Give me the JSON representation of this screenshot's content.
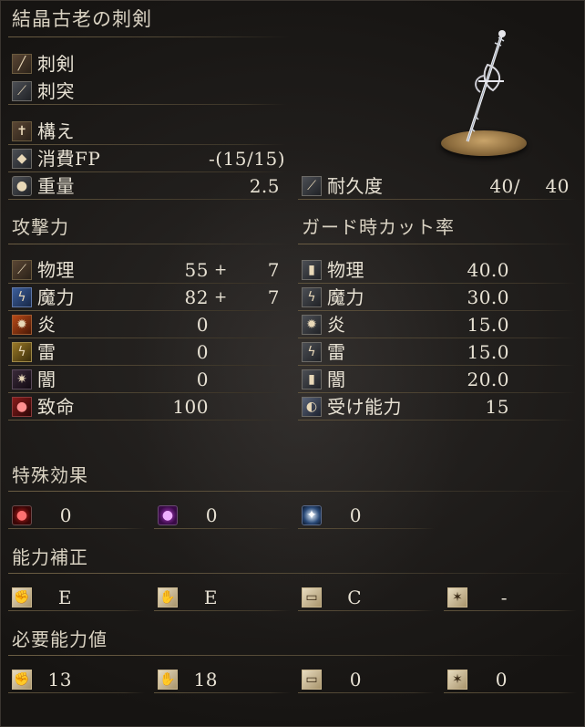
{
  "title": "結晶古老の刺剣",
  "categories": [
    {
      "label": "刺剣",
      "icon": "weapon-type-icon"
    },
    {
      "label": "刺突",
      "icon": "attack-type-icon"
    }
  ],
  "skill": {
    "label": "構え",
    "icon": "skill-icon"
  },
  "fp": {
    "label": "消費FP",
    "value": "-(15/15)",
    "icon": "fp-icon"
  },
  "weight": {
    "label": "重量",
    "value": "2.5",
    "icon": "weight-icon"
  },
  "durability": {
    "label": "耐久度",
    "current": "40/",
    "max": "40",
    "icon": "durability-icon"
  },
  "attack": {
    "heading": "攻撃力",
    "rows": [
      {
        "label": "物理",
        "base": "55",
        "plus": "+",
        "bonus": "7",
        "icon": "physical-icon"
      },
      {
        "label": "魔力",
        "base": "82",
        "plus": "+",
        "bonus": "7",
        "icon": "magic-icon"
      },
      {
        "label": "炎",
        "base": "0",
        "icon": "fire-icon"
      },
      {
        "label": "雷",
        "base": "0",
        "icon": "lightning-icon"
      },
      {
        "label": "闇",
        "base": "0",
        "icon": "dark-icon"
      },
      {
        "label": "致命",
        "base": "100",
        "icon": "critical-icon"
      }
    ]
  },
  "guard": {
    "heading": "ガード時カット率",
    "rows": [
      {
        "label": "物理",
        "value": "40.0",
        "icon": "guard-physical-icon"
      },
      {
        "label": "魔力",
        "value": "30.0",
        "icon": "guard-magic-icon"
      },
      {
        "label": "炎",
        "value": "15.0",
        "icon": "guard-fire-icon"
      },
      {
        "label": "雷",
        "value": "15.0",
        "icon": "guard-lightning-icon"
      },
      {
        "label": "闇",
        "value": "20.0",
        "icon": "guard-dark-icon"
      },
      {
        "label": "受け能力",
        "value": "15",
        "icon": "stability-icon"
      }
    ]
  },
  "special_effects": {
    "heading": "特殊効果",
    "items": [
      {
        "icon": "bleed-icon",
        "value": "0"
      },
      {
        "icon": "poison-icon",
        "value": "0"
      },
      {
        "icon": "frost-icon",
        "value": "0"
      }
    ]
  },
  "scaling": {
    "heading": "能力補正",
    "items": [
      {
        "icon": "strength-icon",
        "value": "E"
      },
      {
        "icon": "dexterity-icon",
        "value": "E"
      },
      {
        "icon": "intelligence-icon",
        "value": "C"
      },
      {
        "icon": "faith-icon",
        "value": "-"
      }
    ]
  },
  "requirements": {
    "heading": "必要能力値",
    "items": [
      {
        "icon": "strength-icon",
        "value": "13"
      },
      {
        "icon": "dexterity-icon",
        "value": "18"
      },
      {
        "icon": "intelligence-icon",
        "value": "0"
      },
      {
        "icon": "faith-icon",
        "value": "0"
      }
    ]
  },
  "colors": {
    "text": "#e8e2d4",
    "divider": "#6b5d43",
    "background": "#1b1917"
  }
}
